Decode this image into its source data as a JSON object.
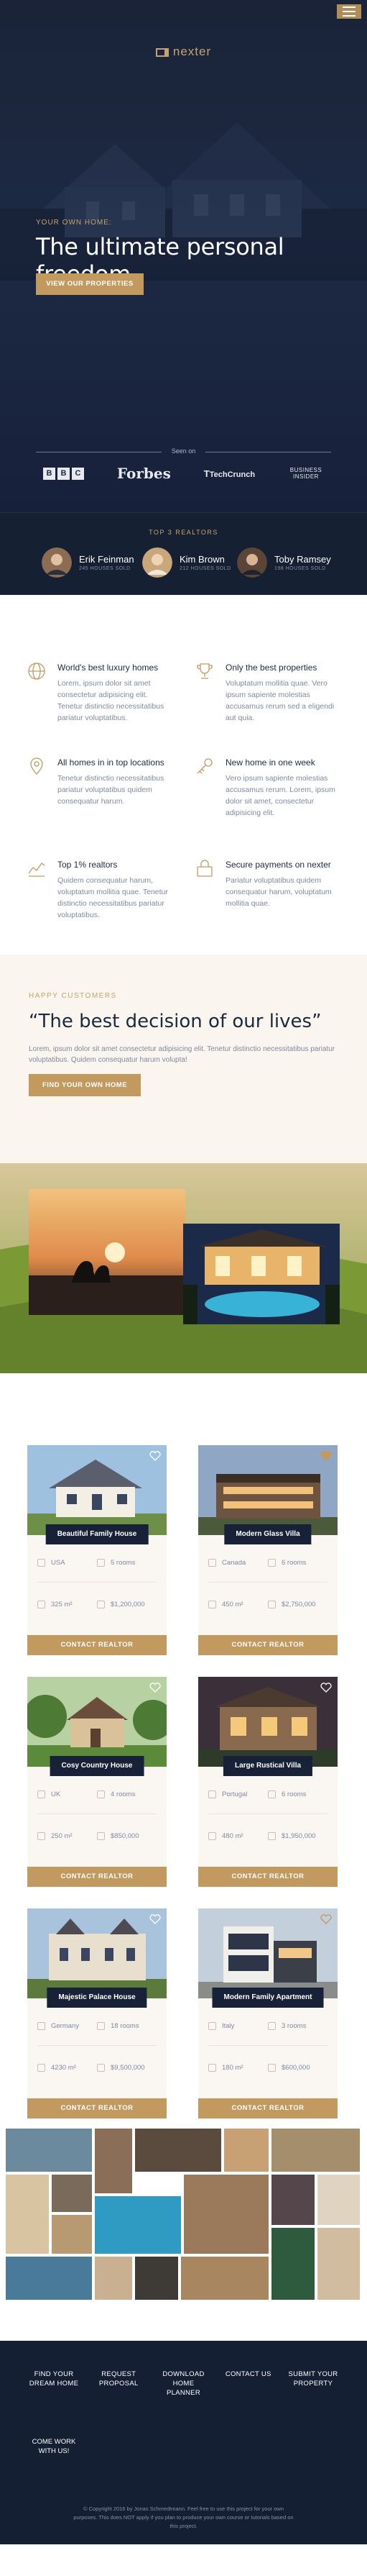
{
  "header": {
    "logo_text": "nexter",
    "menu_icon": "hamburger-icon"
  },
  "hero": {
    "eyebrow": "YOUR OWN HOME:",
    "title": "The ultimate personal freedom",
    "cta_label": "VIEW OUR PROPERTIES",
    "seen_on_label": "Seen on",
    "press": [
      "BBC",
      "Forbes",
      "TechCrunch",
      "BUSINESS INSIDER"
    ]
  },
  "realtors": {
    "heading": "TOP 3 REALTORS",
    "items": [
      {
        "name": "Erik Feinman",
        "role": "245 HOUSES SOLD"
      },
      {
        "name": "Kim Brown",
        "role": "212 HOUSES SOLD"
      },
      {
        "name": "Toby Ramsey",
        "role": "198 HOUSES SOLD"
      }
    ]
  },
  "features": [
    {
      "icon": "globe-icon",
      "title": "World's best luxury homes",
      "body": "Lorem, ipsum dolor sit amet consectetur adipisicing elit. Tenetur distinctio necessitatibus pariatur voluptatibus."
    },
    {
      "icon": "trophy-icon",
      "title": "Only the best properties",
      "body": "Voluptatum mollitia quae. Vero ipsum sapiente molestias accusamus rerum sed a eligendi aut quia."
    },
    {
      "icon": "map-pin-icon",
      "title": "All homes in in top locations",
      "body": "Tenetur distinctio necessitatibus pariatur voluptatibus quidem consequatur harum."
    },
    {
      "icon": "key-icon",
      "title": "New home in one week",
      "body": "Vero ipsum sapiente molestias accusamus rerum. Lorem, ipsum dolor sit amet, consectetur adipisicing elit."
    },
    {
      "icon": "chart-icon",
      "title": "Top 1% realtors",
      "body": "Quidem consequatur harum, voluptatum mollitia quae. Tenetur distinctio necessitatibus pariatur voluptatibus."
    },
    {
      "icon": "lock-icon",
      "title": "Secure payments on nexter",
      "body": "Pariatur voluptatibus quidem consequatur harum, voluptatum mollitia quae."
    }
  ],
  "story": {
    "eyebrow": "HAPPY CUSTOMERS",
    "title": "“The best decision of our lives”",
    "body": "Lorem, ipsum dolor sit amet consectetur adipisicing elit. Tenetur distinctio necessitatibus pariatur voluptatibus. Quidem consequatur harum volupta!",
    "cta_label": "FIND YOUR OWN HOME"
  },
  "homes": [
    {
      "title": "Beautiful Family House",
      "country": "USA",
      "rooms": "5 rooms",
      "area": "325 m²",
      "price": "$1,200,000",
      "cta": "CONTACT REALTOR",
      "favorite": false
    },
    {
      "title": "Modern Glass Villa",
      "country": "Canada",
      "rooms": "6 rooms",
      "area": "450 m²",
      "price": "$2,750,000",
      "cta": "CONTACT REALTOR",
      "favorite": true
    },
    {
      "title": "Cosy Country House",
      "country": "UK",
      "rooms": "4 rooms",
      "area": "250 m²",
      "price": "$850,000",
      "cta": "CONTACT REALTOR",
      "favorite": false
    },
    {
      "title": "Large Rustical Villa",
      "country": "Portugal",
      "rooms": "6 rooms",
      "area": "480 m²",
      "price": "$1,950,000",
      "cta": "CONTACT REALTOR",
      "favorite": false
    },
    {
      "title": "Majestic Palace House",
      "country": "Germany",
      "rooms": "18 rooms",
      "area": "4230 m²",
      "price": "$9,500,000",
      "cta": "CONTACT REALTOR",
      "favorite": false
    },
    {
      "title": "Modern Family Apartment",
      "country": "Italy",
      "rooms": "3 rooms",
      "area": "180 m²",
      "price": "$600,000",
      "cta": "CONTACT REALTOR",
      "favorite": true
    }
  ],
  "footer": {
    "nav": [
      "FIND YOUR DREAM HOME",
      "REQUEST PROPOSAL",
      "DOWNLOAD HOME PLANNER",
      "CONTACT US",
      "SUBMIT YOUR PROPERTY"
    ],
    "nav_extra": "COME WORK WITH US!",
    "copyright": "© Copyright 2016 by Jonas Schmedtmann. Feel free to use this project for your own purposes. This does NOT apply if you plan to produce your own course or tutorials based on this project."
  },
  "colors": {
    "navy": "#172138",
    "gold": "#c29a5f",
    "cream": "#fbf5ef"
  }
}
